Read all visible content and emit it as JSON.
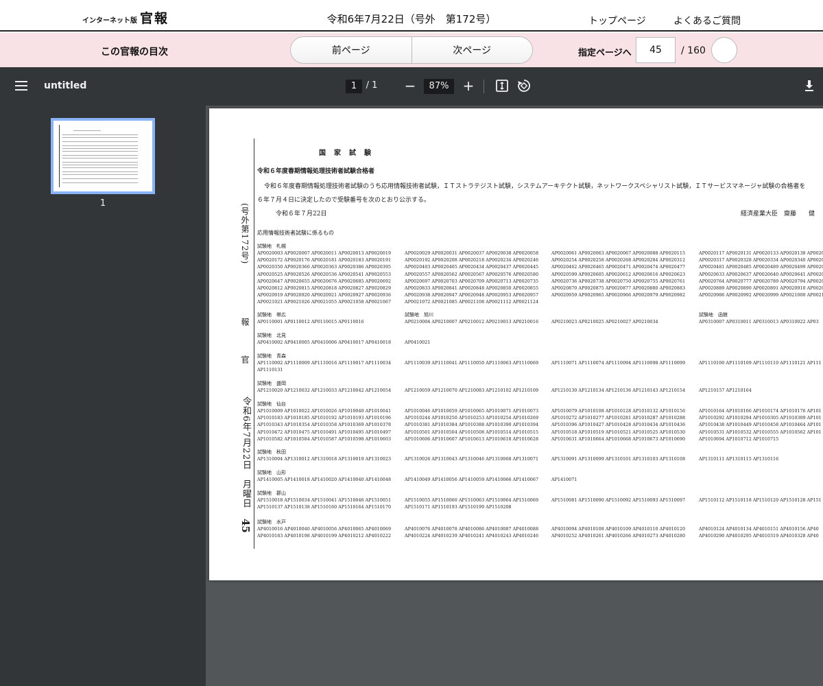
{
  "header": {
    "logo_small": "インターネット版",
    "logo_main": "官報",
    "issue_title": "令和6年7月22日（号外　第172号）",
    "nav_top": "トップページ",
    "nav_faq": "よくあるご質問"
  },
  "kanpo_bar": {
    "toc": "この官報の目次",
    "prev": "前ページ",
    "next": "次ページ",
    "goto_label": "指定ページへ",
    "goto_value": "45",
    "total": "/ 160"
  },
  "viewer": {
    "title": "untitled",
    "page_current": "1",
    "page_total": "/   1",
    "zoom_out": "−",
    "zoom": "87%",
    "zoom_in": "+"
  },
  "sidebar": {
    "thumb_number": "1"
  },
  "document": {
    "vertical_issue": "(号外第172号)",
    "vertical_ho": "報",
    "vertical_kan": "官",
    "vertical_date": "令和6年7月22日　月曜日",
    "vertical_page": "45",
    "heading": "国家試験",
    "subject": "令和６年度春期情報処理技術者試験合格者",
    "body1": "令和６年度春期情報処理技術者試験のうち応用情報技術者試験，ＩＴストラテジスト試験，システムアーキテクト試験，ネットワークスペシャリスト試験，ＩＴサービスマネージャ試験の合格者を",
    "body2": "６年７月４日に決定したので受験番号を次のとおり公示する。",
    "date": "令和６年７月22日",
    "signature": "経済産業大臣　齋藤　　健",
    "section": "応用情報技術者試験に係るもの",
    "blocks": [
      {
        "title": "試験地　札幌",
        "cols": [
          "AP0020003 AP0020007 AP0020011 AP0020013 AP0020019\nAP0020172 AP0020176 AP0020181 AP0020183 AP0020191\nAP0020350 AP0020360 AP0020363 AP0020386 AP0020395\nAP0020525 AP0020526 AP0020536 AP0020541 AP0020553\nAP0020647 AP0020655 AP0020676 AP0020685 AP0020692\nAP0020812 AP0020815 AP0020818 AP0020827 AP0020829\nAP0020919 AP0020920 AP0020921 AP0020927 AP0020936\nAP0021021 AP0021026 AP0021055 AP0021058 AP0021067",
          "AP0020029 AP0020031 AP0020037 AP0020038 AP0020058\nAP0020192 AP0020208 AP0020218 AP0020234 AP0020246\nAP0020403 AP0020405 AP0020434 AP0020437 AP0020445\nAP0020557 AP0020562 AP0020567 AP0020576 AP0020580\nAP0020697 AP0020703 AP0020709 AP0020713 AP0020735\nAP0020833 AP0020841 AP0020848 AP0020850 AP0020855\nAP0020938 AP0020947 AP0020948 AP0020953 AP0020957\nAP0021072 AP0021085 AP0021108 AP0021112 AP0021124",
          "AP0020061 AP0020063 AP0020067 AP0020088 AP0020115\nAP0020254 AP0020258 AP0020268 AP0020284 AP0020312\nAP0020462 AP0020465 AP0020471 AP0020474 AP0020477\nAP0020599 AP0020605 AP0020612 AP0020616 AP0020623\nAP0020736 AP0020738 AP0020750 AP0020755 AP0020761\nAP0020870 AP0020875 AP0020877 AP0020880 AP0020883\nAP0020959 AP0020965 AP0020966 AP0020979 AP0020982",
          "AP0020117 AP0020131 AP0020133 AP0020138 AP0020\nAP0020317 AP0020328 AP0020334 AP0020340 AP0020\nAP0020481 AP0020485 AP0020489 AP0020499 AP0020\nAP0020633 AP0020637 AP0020640 AP0020641 AP0020\nAP0020764 AP0020777 AP0020789 AP0020794 AP0020\nAP0020889 AP0020890 AP0020891 AP0020910 AP0020\nAP0020986 AP0020992 AP0020999 AP0021000 AP0021"
        ]
      },
      {
        "title": "試験地　帯広",
        "cols": [
          "AP0110001 AP0110012 AP0110015 AP0110016",
          "AP0210004 AP0210007 AP0210012 AP0210013 AP0210016",
          "AP0210023 AP0210025 AP0210027 AP0210034",
          "AP0310007 AP0310011 AP0310013 AP0310022 AP03"
        ],
        "title2": "試験地　旭川",
        "title4": "試験地　函館"
      },
      {
        "title": "試験地　北見",
        "cols": [
          "AP0410002 AP0410005 AP0410006 AP0410017 AP0410018",
          "AP0410021",
          "",
          ""
        ]
      },
      {
        "title": "試験地　青森",
        "cols": [
          "AP1110002 AP1110009 AP1110016 AP1110017 AP1110034\nAP1110131",
          "AP1110039 AP1110041 AP1110050 AP1110063 AP1110069",
          "AP1110071 AP1110074 AP1110094 AP1110098 AP1110099",
          "AP1110100 AP1110109 AP1110110 AP1110121 AP111"
        ]
      },
      {
        "title": "試験地　盛岡",
        "cols": [
          "AP1210020 AP1210032 AP1210033 AP1210042 AP1210054",
          "AP1210059 AP1210070 AP1210083 AP1210102 AP1210109",
          "AP1210130 AP1210134 AP1210136 AP1210143 AP1210154",
          "AP1210157 AP1210164"
        ]
      },
      {
        "title": "試験地　仙台",
        "cols": [
          "AP1010009 AP1010022 AP1010026 AP1010040 AP1010041\nAP1010183 AP1010185 AP1010192 AP1010193 AP1010196\nAP1010343 AP1010354 AP1010358 AP1010369 AP1010378\nAP1010472 AP1010475 AP1010491 AP1010495 AP1010497\nAP1010582 AP1010584 AP1010587 AP1010598 AP1010603",
          "AP1010046 AP1010059 AP1010065 AP1010071 AP1010073\nAP1010244 AP1010250 AP1010253 AP1010254 AP1010269\nAP1010381 AP1010384 AP1010388 AP1010390 AP1010394\nAP1010501 AP1010504 AP1010508 AP1010514 AP1010515\nAP1010606 AP1010607 AP1010613 AP1010618 AP1010628",
          "AP1010079 AP1010108 AP1010128 AP1010132 AP1010156\nAP1010272 AP1010277 AP1010281 AP1010287 AP1010288\nAP1010396 AP1010427 AP1010428 AP1010434 AP1010436\nAP1010518 AP1010519 AP1010521 AP1010525 AP1010530\nAP1010631 AP1010664 AP1010668 AP1010673 AP1010690",
          "AP1010164 AP1010166 AP1010174 AP1010176 AP101\nAP1010292 AP1010294 AP1010305 AP1010309 AP101\nAP1010438 AP1010449 AP1010458 AP1010464 AP101\nAP1010531 AP1010532 AP1010555 AP1010562 AP101\nAP1010694 AP1010712 AP1010715"
        ]
      },
      {
        "title": "試験地　秋田",
        "cols": [
          "AP1310004 AP1310012 AP1310018 AP1310019 AP1310023",
          "AP1310026 AP1310043 AP1310046 AP1310068 AP1310071",
          "AP1310091 AP1310099 AP1310101 AP1310103 AP1310108",
          "AP1310111 AP1310115 AP1310116"
        ]
      },
      {
        "title": "試験地　山形",
        "cols": [
          "AP1410005 AP1410018 AP1410020 AP1410040 AP1410048",
          "AP1410049 AP1410056 AP1410059 AP1410066 AP1410067",
          "AP1410071",
          ""
        ]
      },
      {
        "title": "試験地　郡山",
        "cols": [
          "AP1510018 AP1510034 AP1510041 AP1510046 AP1510051\nAP1510137 AP1510138 AP1510160 AP1510164 AP1510170",
          "AP1510055 AP1510060 AP1510063 AP1510064 AP1510069\nAP1510171 AP1510193 AP1510199 AP1510208",
          "AP1510081 AP1510090 AP1510092 AP1510093 AP1510097",
          "AP1510112 AP1510118 AP1510120 AP1510128 AP151"
        ]
      },
      {
        "title": "試験地　水戸",
        "cols": [
          "AP4010016 AP4010040 AP4010056 AP4010065 AP4010069\nAP4010183 AP4010198 AP4010199 AP4010212 AP4010222",
          "AP4010076 AP4010078 AP4010086 AP4010087 AP4010088\nAP4010224 AP4010239 AP4010241 AP4010243 AP4010246",
          "AP4010094 AP4010108 AP4010109 AP4010110 AP4010120\nAP4010252 AP4010261 AP4010266 AP4010273 AP4010280",
          "AP4010124 AP4010134 AP4010151 AP4010156 AP40\nAP4010290 AP4010295 AP4010319 AP4010328 AP40"
        ]
      }
    ]
  },
  "colors": {
    "accent_bar": "#f8e2e5",
    "viewer_bg": "#323639",
    "canvas_bg": "#525659",
    "thumb_border": "#8ab4f8"
  }
}
